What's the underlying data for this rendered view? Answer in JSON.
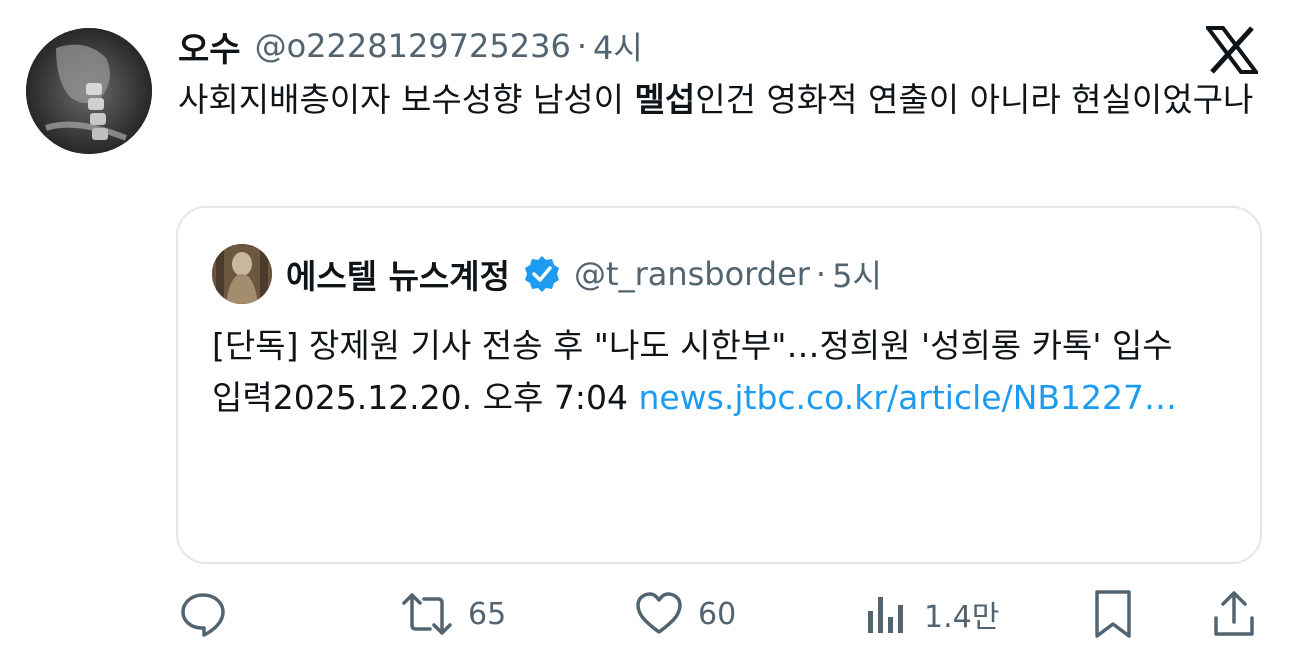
{
  "author": {
    "name": "오수",
    "handle": "@o2228129725236",
    "separator": "·",
    "time": "4시"
  },
  "tweet": {
    "text_before": "사회지배층이자 보수성향 남성이 ",
    "text_bold": "멜섭",
    "text_after": "인건 영화적 연출이 아니라 현실이었구나"
  },
  "quote": {
    "name": "에스텔 뉴스계정",
    "handle": "@t_ransborder",
    "separator": "·",
    "time": "5시",
    "line1": "[단독] 장제원 기사 전송 후 \"나도 시한부\"…정희원 '성희롱 카톡' 입수",
    "line2_prefix": "입력2025.12.20. 오후 7:04 ",
    "link": "news.jtbc.co.kr/article/NB1227…"
  },
  "actions": {
    "reply_icon": "reply-icon",
    "retweet_icon": "retweet-icon",
    "retweet_count": "65",
    "like_icon": "heart-icon",
    "like_count": "60",
    "views_icon": "views-icon",
    "views_count": "1.4만",
    "bookmark_icon": "bookmark-icon",
    "share_icon": "share-icon"
  },
  "colors": {
    "text": "#0f1419",
    "muted": "#536471",
    "link": "#1d9bf0",
    "border": "#e1e8ed"
  }
}
